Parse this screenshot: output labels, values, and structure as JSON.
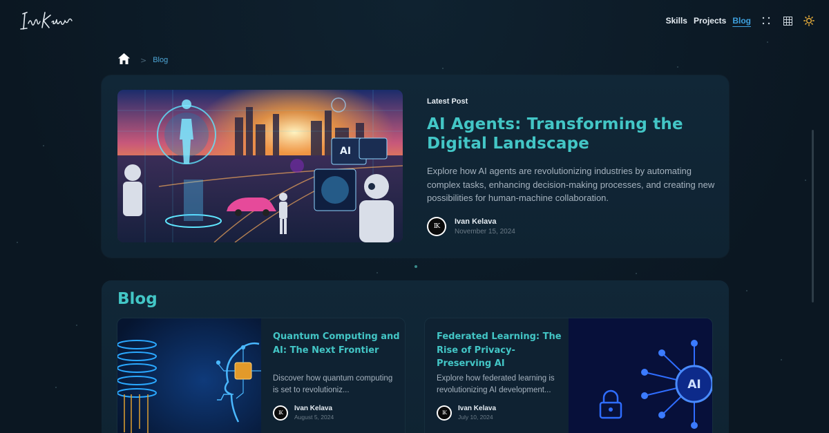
{
  "header": {
    "logo_text": "Ivan Kelava",
    "nav": [
      {
        "label": "Skills",
        "active": false
      },
      {
        "label": "Projects",
        "active": false
      },
      {
        "label": "Blog",
        "active": true
      }
    ],
    "icons": [
      "dots-icon",
      "grid-icon",
      "sun-icon"
    ]
  },
  "breadcrumb": {
    "home_icon": "home-icon",
    "separator": ">",
    "current": "Blog"
  },
  "latest": {
    "kicker": "Latest Post",
    "title": "AI Agents: Transforming the Digital Landscape",
    "excerpt": "Explore how AI agents are revolutionizing industries by automating complex tasks, enhancing decision-making processes, and creating new possibilities for human-machine collaboration.",
    "author": {
      "initials": "IK",
      "name": "Ivan Kelava",
      "date": "November 15, 2024"
    },
    "image_label": "AI"
  },
  "blog": {
    "heading": "Blog",
    "posts": [
      {
        "title": "Quantum Computing and AI: The Next Frontier",
        "excerpt": "Discover how quantum computing is set to revolutioniz...",
        "author": {
          "initials": "IK",
          "name": "Ivan Kelava",
          "date": "August 5, 2024"
        }
      },
      {
        "title": "Federated Learning: The Rise of Privacy-Preserving AI",
        "excerpt": "Explore how federated learning is revolutionizing AI development...",
        "author": {
          "initials": "IK",
          "name": "Ivan Kelava",
          "date": "July 10, 2024"
        },
        "image_label": "AI"
      }
    ]
  },
  "colors": {
    "background": "#0c1a26",
    "card": "#112737",
    "accent_teal": "#43c6c6",
    "accent_blue": "#3ea2e0",
    "text": "#e6edf3",
    "muted": "#a6b3bf"
  }
}
